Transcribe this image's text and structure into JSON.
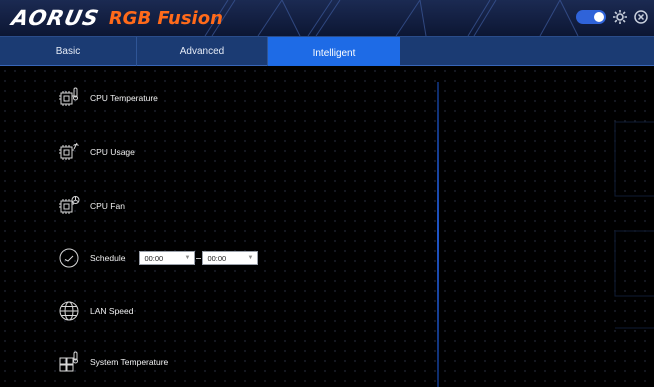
{
  "app": {
    "title": "RGB Fusion",
    "brand": "AORUS"
  },
  "tabs": [
    {
      "label": "Basic",
      "active": false
    },
    {
      "label": "Advanced",
      "active": false
    },
    {
      "label": "Intelligent",
      "active": true
    }
  ],
  "items": [
    {
      "label": "CPU Temperature",
      "icon": "cpu-temperature-icon"
    },
    {
      "label": "CPU Usage",
      "icon": "cpu-usage-icon"
    },
    {
      "label": "CPU Fan",
      "icon": "cpu-fan-icon"
    },
    {
      "label": "Schedule",
      "icon": "clock-icon"
    },
    {
      "label": "LAN Speed",
      "icon": "globe-icon"
    },
    {
      "label": "System Temperature",
      "icon": "system-temperature-icon"
    }
  ],
  "schedule": {
    "start": "00:00",
    "end": "00:00"
  },
  "colors": {
    "accent": "#1e6be6",
    "brand": "#ff6a1a",
    "tabbar": "#1b3b73",
    "titlebar": "#1b2a52"
  }
}
